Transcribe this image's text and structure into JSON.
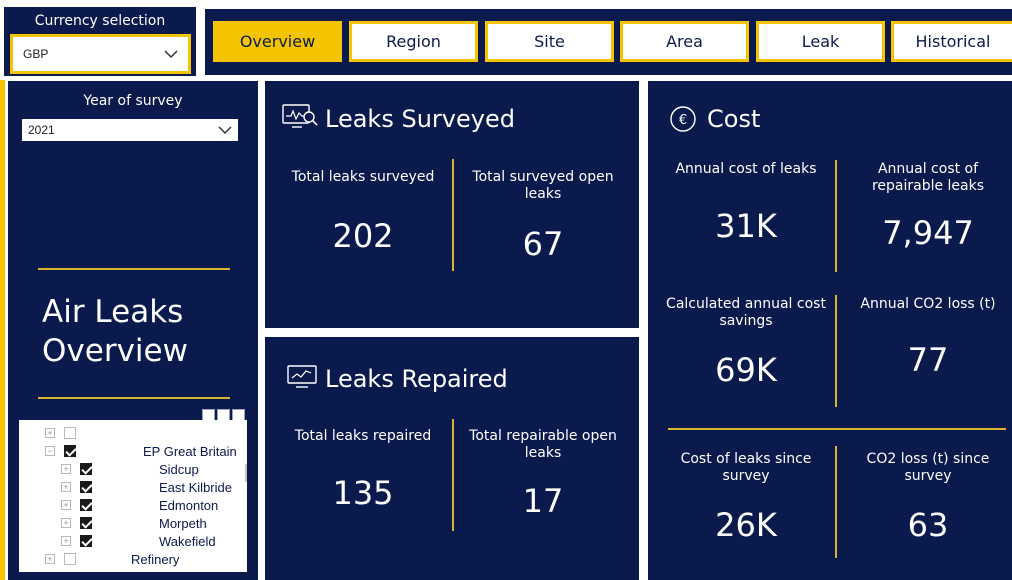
{
  "currency": {
    "title": "Currency selection",
    "selected": "GBP"
  },
  "tabs": [
    {
      "label": "Overview",
      "active": true
    },
    {
      "label": "Region",
      "active": false
    },
    {
      "label": "Site",
      "active": false
    },
    {
      "label": "Area",
      "active": false
    },
    {
      "label": "Leak",
      "active": false
    },
    {
      "label": "Historical",
      "active": false
    }
  ],
  "sidebar": {
    "year_title": "Year of survey",
    "year_selected": "2021",
    "page_title_line1": "Air Leaks",
    "page_title_line2": "Overview",
    "tree": [
      {
        "label": "",
        "checked": false,
        "level": 0,
        "expander": "+"
      },
      {
        "label": "EP Great Britain",
        "checked": true,
        "level": 0,
        "expander": "−"
      },
      {
        "label": "Sidcup",
        "checked": true,
        "level": 1,
        "expander": "+"
      },
      {
        "label": "East Kilbride",
        "checked": true,
        "level": 1,
        "expander": "+"
      },
      {
        "label": "Edmonton",
        "checked": true,
        "level": 1,
        "expander": "+"
      },
      {
        "label": "Morpeth",
        "checked": true,
        "level": 1,
        "expander": "+"
      },
      {
        "label": "Wakefield",
        "checked": true,
        "level": 1,
        "expander": "+"
      },
      {
        "label": "Refinery",
        "checked": false,
        "level": 0,
        "expander": "+"
      }
    ]
  },
  "surveyed": {
    "title": "Leaks Surveyed",
    "kpis": [
      {
        "label": "Total leaks surveyed",
        "value": "202"
      },
      {
        "label": "Total surveyed open leaks",
        "value": "67"
      }
    ]
  },
  "repaired": {
    "title": "Leaks Repaired",
    "kpis": [
      {
        "label": "Total leaks repaired",
        "value": "135"
      },
      {
        "label": "Total repairable open leaks",
        "value": "17"
      }
    ]
  },
  "cost": {
    "title": "Cost",
    "kpis": [
      {
        "label": "Annual cost of leaks",
        "value": "31K"
      },
      {
        "label": "Annual cost of repairable leaks",
        "value": "7,947"
      },
      {
        "label": "Calculated annual cost savings",
        "value": "69K"
      },
      {
        "label": "Annual CO2 loss (t)",
        "value": "77"
      },
      {
        "label": "Cost of leaks since survey",
        "value": "26K"
      },
      {
        "label": "CO2 loss (t) since survey",
        "value": "63"
      }
    ]
  },
  "colors": {
    "navy": "#0b1a4d",
    "gold": "#f5c400",
    "divider": "#d8b430"
  }
}
